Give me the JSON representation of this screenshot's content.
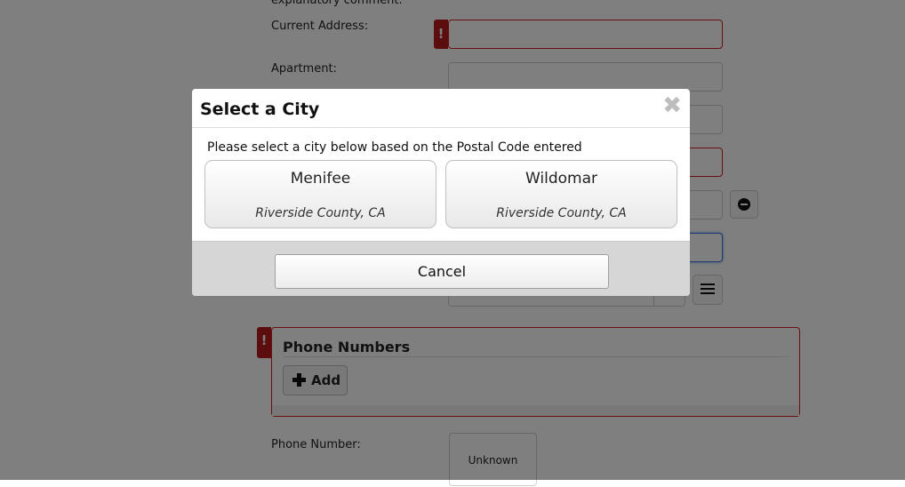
{
  "form": {
    "top_text": "explanatory comment.",
    "current_address_label": "Current Address:",
    "apartment_label": "Apartment:",
    "phone_section_title": "Phone Numbers",
    "add_label": "Add",
    "phone_number_label": "Phone Number:",
    "unknown_label": "Unknown"
  },
  "modal": {
    "title": "Select a City",
    "close_symbol": "✖",
    "message": "Please select a city below based on the Postal Code entered",
    "cities": [
      {
        "name": "Menifee",
        "county": "Riverside County, CA"
      },
      {
        "name": "Wildomar",
        "county": "Riverside County, CA"
      }
    ],
    "cancel_label": "Cancel"
  },
  "colors": {
    "error": "#d61f1f",
    "error_flag": "#b81d1d",
    "overlay": "rgba(0,0,0,0.5)",
    "focus": "#3b78d8"
  },
  "icons": [
    "error-flag-icon",
    "close-icon",
    "minus-circle-icon",
    "list-icon",
    "plus-icon",
    "chevron-down-icon"
  ]
}
